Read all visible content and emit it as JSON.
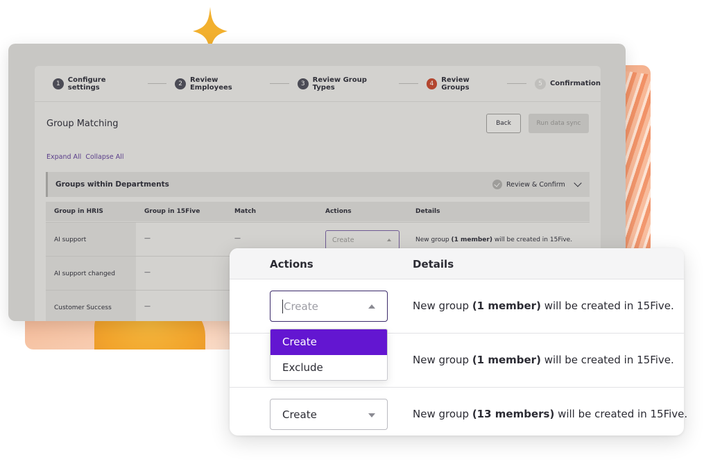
{
  "stepper": {
    "steps": [
      {
        "num": "1",
        "label": "Configure settings"
      },
      {
        "num": "2",
        "label": "Review Employees"
      },
      {
        "num": "3",
        "label": "Review Group Types"
      },
      {
        "num": "4",
        "label": "Review Groups"
      },
      {
        "num": "5",
        "label": "Confirmation"
      }
    ],
    "active_step": 4
  },
  "page": {
    "title": "Group Matching",
    "back_label": "Back",
    "run_sync_label": "Run data sync",
    "expand_all": "Expand All",
    "collapse_all": "Collapse All"
  },
  "section": {
    "title": "Groups within Departments",
    "review_confirm": "Review & Confirm"
  },
  "table": {
    "headers": [
      "Group in HRIS",
      "Group in 15Five",
      "Match",
      "Actions",
      "Details"
    ],
    "rows": [
      {
        "hris": "AI support",
        "fifteen": "—",
        "match": "—",
        "action_placeholder": "Create",
        "details": "New group ",
        "details_bold": "(1 member)",
        "details_tail": " will be created in 15Five."
      },
      {
        "hris": "AI support changed",
        "fifteen": "—"
      },
      {
        "hris": "Customer Success",
        "fifteen": "—"
      }
    ]
  },
  "card": {
    "headers": {
      "actions": "Actions",
      "details": "Details"
    },
    "rows": [
      {
        "select_text": "Create",
        "select_state": "open",
        "details_pre": "New group ",
        "details_bold": "(1 member)",
        "details_post": " will be created in 15Five."
      },
      {
        "details_pre": "New group ",
        "details_bold": "(1 member)",
        "details_post": " will be created in 15Five."
      },
      {
        "select_text": "Create",
        "select_state": "closed",
        "details_pre": "New group ",
        "details_bold": "(13 members)",
        "details_post": " will be created in 15Five."
      }
    ],
    "dropdown_options": [
      "Create",
      "Exclude"
    ],
    "dropdown_selected": "Create"
  },
  "colors": {
    "accent_purple": "#6316d1",
    "active_step": "#b3462f",
    "sparkle": "#f2b02e"
  },
  "icons": [
    "sparkle-icon",
    "check-circle-icon",
    "chevron-down-icon",
    "caret-up-icon",
    "caret-down-icon"
  ]
}
